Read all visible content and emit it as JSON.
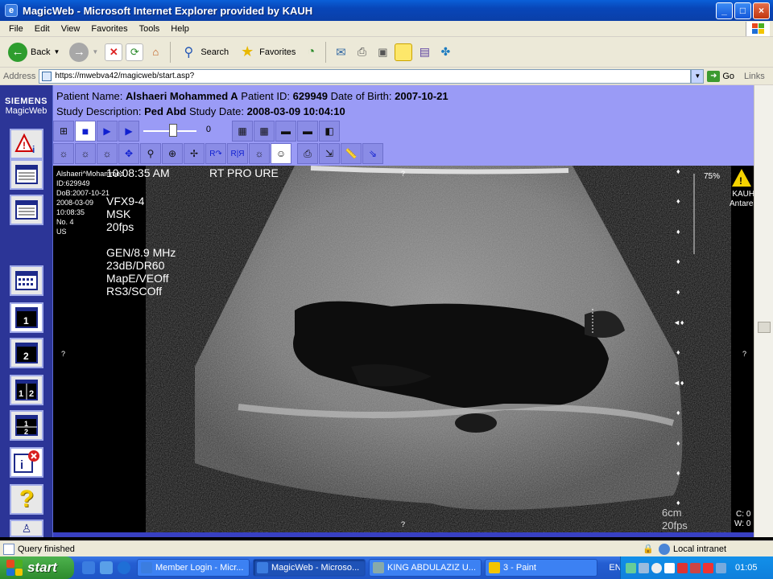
{
  "window": {
    "title": "MagicWeb - Microsoft Internet Explorer provided by KAUH",
    "min": "_",
    "max": "□",
    "close": "×"
  },
  "menu": [
    "File",
    "Edit",
    "View",
    "Favorites",
    "Tools",
    "Help"
  ],
  "toolbar": {
    "back": "Back",
    "search": "Search",
    "favorites": "Favorites"
  },
  "address": {
    "label": "Address",
    "url": "https://mwebva42/magicweb/start.asp?",
    "go": "Go",
    "links": "Links"
  },
  "sidebar": {
    "brand": "SIEMENS",
    "product": "MagicWeb"
  },
  "patient": {
    "name_label": "Patient Name:",
    "name": "Alshaeri Mohammed A",
    "id_label": "Patient ID:",
    "id": "629949",
    "dob_label": "Date of Birth:",
    "dob": "2007-10-21",
    "study_label": "Study Description:",
    "study": "Ped Abd",
    "date_label": "Study Date:",
    "date": "2008-03-09 10:04:10"
  },
  "slider": {
    "value": "0"
  },
  "overlay": {
    "info_lines": [
      "Alshaeri^Mohammed",
      "ID:629949",
      "DoB:2007-10-21",
      "2008-03-09",
      "10:08:35",
      "No. 4",
      "US"
    ],
    "time": "10:08:35 AM",
    "orientation": "RT  PRO  URE",
    "probe_lines": [
      "VFX9-4",
      "MSK",
      "20fps",
      "",
      "GEN/8.9 MHz",
      "23dB/DR60",
      "MapE/VEOff",
      "RS3/SCOff"
    ],
    "zoom": "75%",
    "site_lines": [
      "KAUH",
      "Antares"
    ],
    "depth": "6cm",
    "fps": "20fps",
    "c": "C: 0",
    "w": "W: 0",
    "q": "?"
  },
  "status": {
    "text": "Query finished",
    "zone": "Local intranet"
  },
  "taskbar": {
    "start": "start",
    "tasks": [
      "Member Login - Micr...",
      "MagicWeb - Microso...",
      "KING ABDULAZIZ U...",
      "3 - Paint"
    ],
    "lang": "EN",
    "clock": "01:05"
  },
  "colors": {
    "header": "#9a9bf6",
    "sidebar": "#2c3597",
    "titlebar": "#0846b8"
  }
}
